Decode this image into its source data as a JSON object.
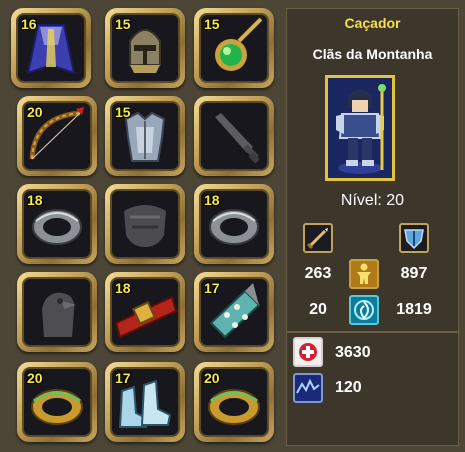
{
  "equipment": {
    "slots": [
      {
        "name": "cape",
        "level": "16",
        "icon": "blue-cape-icon"
      },
      {
        "name": "helmet",
        "level": "15",
        "icon": "knight-helmet-icon"
      },
      {
        "name": "amulet",
        "level": "15",
        "icon": "emerald-amulet-icon"
      },
      {
        "name": "bow",
        "level": "20",
        "icon": "bow-icon"
      },
      {
        "name": "armor",
        "level": "15",
        "icon": "steel-armor-icon"
      },
      {
        "name": "sword",
        "level": "",
        "icon": "sword-silhouette-icon"
      },
      {
        "name": "ring-left",
        "level": "18",
        "icon": "silver-ring-icon"
      },
      {
        "name": "gloves",
        "level": "",
        "icon": "gloves-silhouette-icon"
      },
      {
        "name": "ring-right",
        "level": "18",
        "icon": "silver-ring-icon"
      },
      {
        "name": "pet",
        "level": "",
        "icon": "bird-silhouette-icon"
      },
      {
        "name": "belt",
        "level": "18",
        "icon": "red-belt-icon"
      },
      {
        "name": "bracer",
        "level": "17",
        "icon": "spiked-bracer-icon"
      },
      {
        "name": "ring-2-left",
        "level": "20",
        "icon": "gold-ring-icon"
      },
      {
        "name": "boots",
        "level": "17",
        "icon": "ice-boots-icon"
      },
      {
        "name": "ring-2-right",
        "level": "20",
        "icon": "gold-ring-icon"
      }
    ]
  },
  "character": {
    "class_name": "Caçador",
    "clan": "Clãs da Montanha",
    "level_text": "Nível: 20",
    "attack": "263",
    "defense": "897",
    "stat_a": "20",
    "stat_b": "1819",
    "hp": "3630",
    "mp": "120"
  },
  "colors": {
    "panel_bg": "#3d372b",
    "title_yellow": "#f3e04a",
    "frame_gold": "#c9a85e"
  }
}
